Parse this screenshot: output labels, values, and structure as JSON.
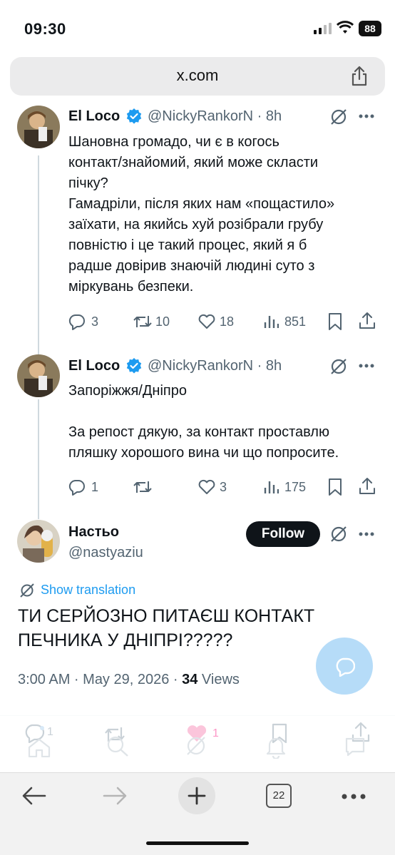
{
  "status_bar": {
    "time": "09:30",
    "battery": "88"
  },
  "browser": {
    "url": "x.com",
    "tabs_count": "22"
  },
  "tweets": [
    {
      "name": "El Loco",
      "handle": "@NickyRankorN · 8h",
      "text": "Шановна громадо, чи є в когось\nконтакт/знайомий, який може скласти\nпічку?\nГамадріли, після яких нам «пощастило»\nзаїхати, на якийсь хуй розібрали грубу\nповністю і це такий процес, який я б\nрадше довірив знаючій людині суто з\nміркувань безпеки.",
      "replies": "3",
      "reposts": "10",
      "likes": "18",
      "views": "851"
    },
    {
      "name": "El Loco",
      "handle": "@NickyRankorN · 8h",
      "text": "Запоріжжя/Дніпро\n\nЗа репост дякую, за контакт проставлю\nпляшку хорошого вина чи що попросите.",
      "replies": "1",
      "reposts": "",
      "likes": "3",
      "views": "175"
    }
  ],
  "main_tweet": {
    "name": "Настьо",
    "handle": "@nastyaziu",
    "follow_label": "Follow",
    "translation_label": "Show translation",
    "text": "ТИ СЕРЙОЗНО ПИТАЄШ КОНТАКТ ПЕЧНИКА У ДНІПРІ?????",
    "time": "3:00 AM · May 29, 2026 · ",
    "views_count": "34",
    "views_label": " Views",
    "replies": "1",
    "likes": "1"
  },
  "colors": {
    "accent": "#1d9bf0",
    "like": "#f91880",
    "text": "#0f1419",
    "muted": "#536471"
  }
}
